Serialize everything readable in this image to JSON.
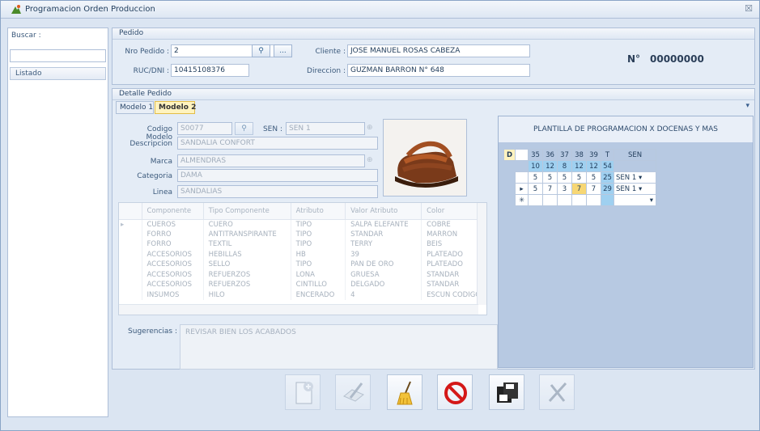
{
  "window": {
    "title": "Programacion Orden Produccion",
    "close_glyph": "☒"
  },
  "left": {
    "search_label": "Buscar :",
    "search_value": "",
    "list_header": "Listado"
  },
  "pedido": {
    "header": "Pedido",
    "nro_label": "Nro Pedido :",
    "nro_value": "2",
    "search_btn": "⚲",
    "more_btn": "...",
    "ruc_label": "RUC/DNI :",
    "ruc_value": "10415108376",
    "cliente_label": "Cliente :",
    "cliente_value": "JOSE MANUEL ROSAS CABEZA",
    "direccion_label": "Direccion :",
    "direccion_value": "GUZMAN BARRON N° 648",
    "numero_label": "N°",
    "numero_value": "00000000"
  },
  "detalle": {
    "header": "Detalle Pedido",
    "tabs": [
      "Modelo 1",
      "Modelo 2"
    ],
    "codigo_label": "Codigo Modelo",
    "codigo_value": "S0077",
    "sen_label": "SEN :",
    "sen_value": "SEN 1",
    "descripcion_label": "Descripcion",
    "descripcion_value": "SANDALIA CONFORT",
    "marca_label": "Marca",
    "marca_value": "ALMENDRAS",
    "categoria_label": "Categoria",
    "categoria_value": "DAMA",
    "linea_label": "Linea",
    "linea_value": "SANDALIAS",
    "columns": [
      "Componente",
      "Tipo Componente",
      "Atributo",
      "Valor Atributo",
      "Color"
    ],
    "rows": [
      [
        "CUEROS",
        "CUERO",
        "TIPO",
        "SALPA ELEFANTE",
        "COBRE"
      ],
      [
        "FORRO",
        "ANTITRANSPIRANTE",
        "TIPO",
        "STANDAR",
        "MARRON"
      ],
      [
        "FORRO",
        "TEXTIL",
        "TIPO",
        "TERRY",
        "BEIS"
      ],
      [
        "ACCESORIOS",
        "HEBILLAS",
        "HB",
        "39",
        "PLATEADO"
      ],
      [
        "ACCESORIOS",
        "SELLO",
        "TIPO",
        "PAN DE ORO",
        "PLATEADO"
      ],
      [
        "ACCESORIOS",
        "REFUERZOS",
        "LONA",
        "GRUESA",
        "STANDAR"
      ],
      [
        "ACCESORIOS",
        "REFUERZOS",
        "CINTILLO",
        "DELGADO",
        "STANDAR"
      ],
      [
        "INSUMOS",
        "HILO",
        "ENCERADO",
        "4",
        "ESCUN CODIGO"
      ]
    ],
    "sugerencias_label": "Sugerencias :",
    "sugerencias_value": "REVISAR BIEN  LOS ACABADOS"
  },
  "plantilla": {
    "title": "PLANTILLA DE PROGRAMACION X DOCENAS Y MAS",
    "corner": "D",
    "headers": [
      "35",
      "36",
      "37",
      "38",
      "39",
      "T",
      "SEN"
    ],
    "totals": [
      "10",
      "12",
      "8",
      "12",
      "12",
      "54"
    ],
    "rows": [
      [
        "5",
        "5",
        "5",
        "5",
        "5",
        "25",
        "SEN 1"
      ],
      [
        "5",
        "7",
        "3",
        "7",
        "7",
        "29",
        "SEN 1"
      ]
    ]
  },
  "colors": {
    "accent_yellow": "#fff3bf",
    "grid_blue": "#9fd0f0",
    "highlight": "#f7d774",
    "stop_red": "#d41818"
  },
  "toolbar": {
    "buttons": [
      "new-document-icon",
      "sign-icon",
      "broom-icon",
      "stop-icon",
      "save-icon",
      "close-icon"
    ]
  }
}
